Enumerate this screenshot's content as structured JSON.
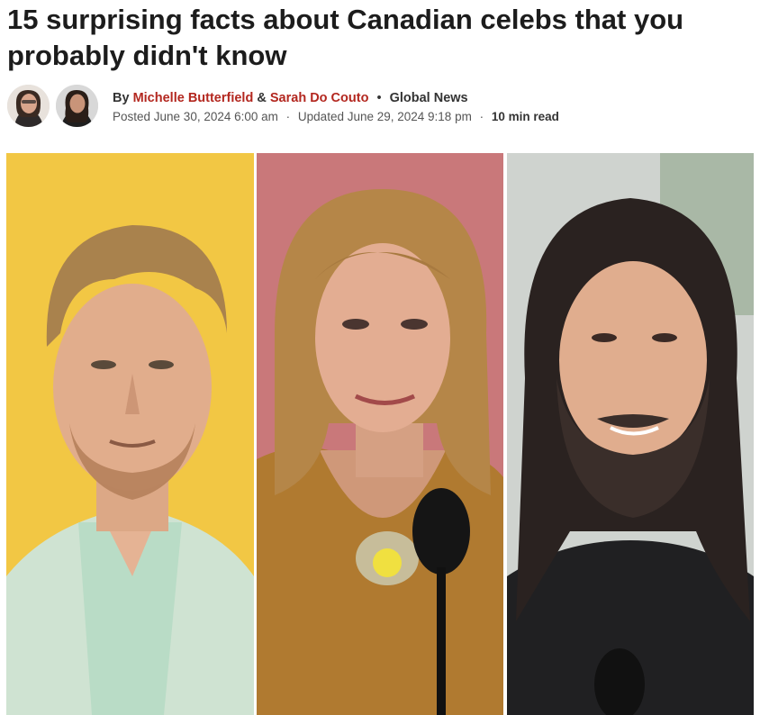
{
  "article": {
    "headline": "15 surprising facts about Canadian celebs that you probably didn't know",
    "byline": {
      "by": "By",
      "author1": "Michelle Butterfield",
      "amp": "&",
      "author2": "Sarah Do Couto",
      "separator": "•",
      "outlet": "Global News",
      "posted": "Posted June 30, 2024 6:00 am",
      "mid_sep": "·",
      "updated": "Updated June 29, 2024 9:18 pm",
      "read_time": "10 min read"
    }
  },
  "colors": {
    "author_link": "#b3271f",
    "panel1_bg": "#f2c744",
    "panel2_bg": "#c9787a",
    "panel3_bg": "#cfd3cf"
  },
  "images": [
    {
      "name": "celebrity-photo-1"
    },
    {
      "name": "celebrity-photo-2"
    },
    {
      "name": "celebrity-photo-3"
    }
  ]
}
